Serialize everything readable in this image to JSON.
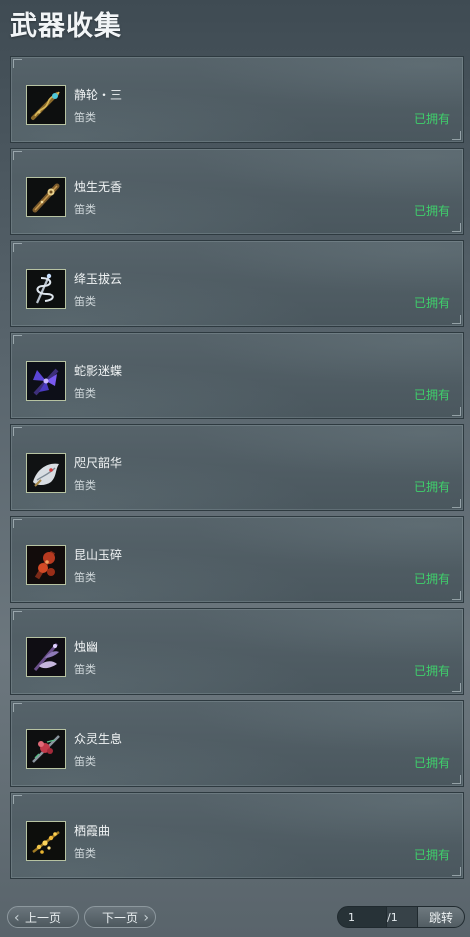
{
  "header": {
    "title": "武器收集"
  },
  "weapons": [
    {
      "name": "静轮・三",
      "type": "笛类",
      "status": "已拥有",
      "icon": "golden-flute-icon"
    },
    {
      "name": "烛生无香",
      "type": "笛类",
      "status": "已拥有",
      "icon": "bronze-flute-icon"
    },
    {
      "name": "绛玉拔云",
      "type": "笛类",
      "status": "已拥有",
      "icon": "silver-dragon-flute-icon"
    },
    {
      "name": "蛇影迷蝶",
      "type": "笛类",
      "status": "已拥有",
      "icon": "purple-butterfly-flute-icon"
    },
    {
      "name": "咫尺韶华",
      "type": "笛类",
      "status": "已拥有",
      "icon": "white-beast-flute-icon"
    },
    {
      "name": "昆山玉碎",
      "type": "笛类",
      "status": "已拥有",
      "icon": "red-jade-flute-icon"
    },
    {
      "name": "烛幽",
      "type": "笛类",
      "status": "已拥有",
      "icon": "violet-feather-flute-icon"
    },
    {
      "name": "众灵生息",
      "type": "笛类",
      "status": "已拥有",
      "icon": "red-blossom-flute-icon"
    },
    {
      "name": "栖霞曲",
      "type": "笛类",
      "status": "已拥有",
      "icon": "gold-blossom-flute-icon"
    }
  ],
  "pager": {
    "prev_label": "上一页",
    "next_label": "下一页",
    "current_page": "1",
    "total_label": "/1",
    "jump_label": "跳转"
  },
  "colors": {
    "owned": "#3fd06b",
    "icon_border": "#b7c3a2"
  }
}
